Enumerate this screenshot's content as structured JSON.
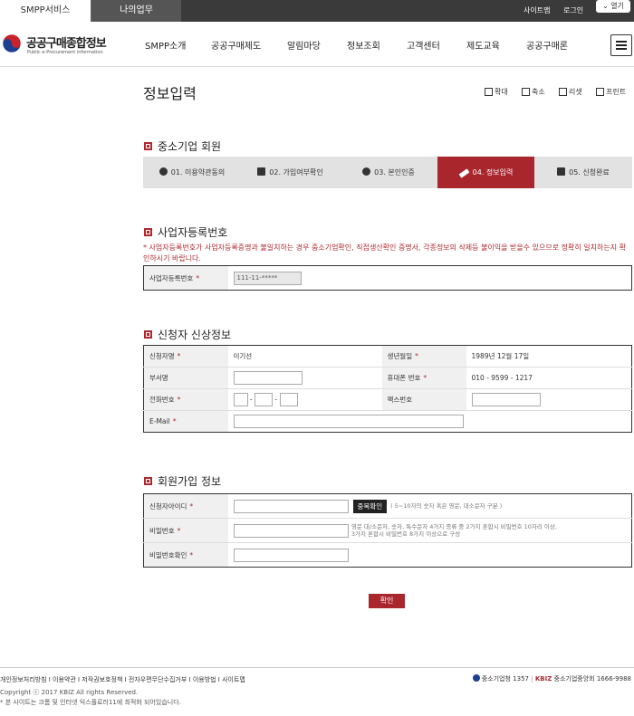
{
  "topbar": {
    "tab_smpp": "SMPP서비스",
    "tab_mywork": "나의업무",
    "sitemap": "사이트맵",
    "login": "로그인",
    "open": "열기"
  },
  "logo": {
    "title": "공공구매종합정보",
    "subtitle": "Public e-Procurement information"
  },
  "gnb": [
    "SMPP소개",
    "공공구매제도",
    "알림마당",
    "정보조회",
    "고객센터",
    "제도교육",
    "공공구매론"
  ],
  "page": {
    "title": "정보입력",
    "tools": {
      "zoom_in": "확대",
      "zoom_out": "축소",
      "reset": "리셋",
      "print": "프린트"
    }
  },
  "member_section": {
    "title": "중소기업 회원",
    "steps": [
      {
        "label": "01. 이용약관동의",
        "icon": "check-circle-icon"
      },
      {
        "label": "02. 가입여부확인",
        "icon": "monitor-icon"
      },
      {
        "label": "03. 본인인증",
        "icon": "person-icon"
      },
      {
        "label": "04. 정보입력",
        "icon": "pencil-icon",
        "active": true
      },
      {
        "label": "05. 신청완료",
        "icon": "checkbox-icon"
      }
    ]
  },
  "bizreg_section": {
    "title": "사업자등록번호",
    "warning": "* 사업자등록번호가 사업자등록증명과 불일치하는 경우 중소기업확인, 직접생산확인 증명서, 각종정보의 삭제등 불이익을 받을수 있으므로 정확히 일치하는지 확인하시기 바랍니다.",
    "label": "사업자등록번호",
    "value": "111-11-*****"
  },
  "applicant_section": {
    "title": "신청자 신상정보",
    "name_label": "신청자명",
    "name_value": "이기선",
    "birth_label": "생년월일",
    "birth_value": "1989년 12월 17일",
    "dept_label": "부서명",
    "mobile_label": "휴대폰 번호",
    "mobile_value": "010 - 9599 - 1217",
    "phone_label": "전화번호",
    "fax_label": "팩스번호",
    "email_label": "E-Mail"
  },
  "join_section": {
    "title": "회원가입 정보",
    "id_label": "신청자아이디",
    "dup_button": "중복확인",
    "id_hint": "( 5~10자의 숫자 혹은 영문, 대소문자 구분 )",
    "pw_label": "비밀번호",
    "pw_hint_1": "영문 대/소문자, 숫자, 특수문자 4가지 종류 중 2가지 혼합시 비밀번호 10자리 이상,",
    "pw_hint_2": "3가지 혼합시 비밀번호 8가지 이상으로 구성",
    "pw_confirm_label": "비밀번호확인"
  },
  "confirm_button": "확인",
  "footer": {
    "links": "개인정보처리방침  I  이용약관  I  저작권보호정책  I  전자우편무단수집거부  I  이용방법  I  사이트맵",
    "copyright": "Copyright ⓒ 2017 KBIZ All rights Reserved.",
    "notice": "* 본 사이트는 크롬 및 인터넷 익스플로러11에 최적화 되어있습니다.",
    "mss": "중소기업청",
    "mss_phone": "1357",
    "kbiz": "KBIZ",
    "kbiz_name": "중소기업중앙회",
    "kbiz_phone": "1666-9988"
  },
  "colors": {
    "accent": "#a9262d",
    "topbar": "#3a3a3a"
  }
}
